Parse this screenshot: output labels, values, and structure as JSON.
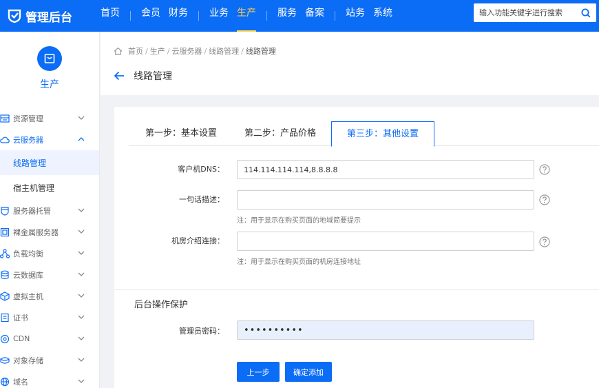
{
  "brand": {
    "logo_text": "管理后台"
  },
  "nav": {
    "items": [
      "首页",
      "会员",
      "财务",
      "业务",
      "生产",
      "服务",
      "备案",
      "站务",
      "系统"
    ],
    "active": "生产"
  },
  "search": {
    "placeholder": "输入功能关键字进行搜索"
  },
  "sidebar": {
    "title": "生产",
    "menu": [
      {
        "label": "资源管理",
        "icon": "resource-icon",
        "open": false
      },
      {
        "label": "云服务器",
        "icon": "cloud-icon",
        "open": true,
        "children": [
          {
            "label": "线路管理",
            "active": true
          },
          {
            "label": "宿主机管理",
            "active": false
          }
        ]
      },
      {
        "label": "服务器托管",
        "icon": "server-hosting-icon",
        "open": false
      },
      {
        "label": "裸金属服务器",
        "icon": "bare-metal-icon",
        "open": false
      },
      {
        "label": "负载均衡",
        "icon": "load-balance-icon",
        "open": false
      },
      {
        "label": "云数据库",
        "icon": "database-icon",
        "open": false
      },
      {
        "label": "虚拟主机",
        "icon": "virtual-host-icon",
        "open": false
      },
      {
        "label": "证书",
        "icon": "certificate-icon",
        "open": false
      },
      {
        "label": "CDN",
        "icon": "cdn-icon",
        "open": false
      },
      {
        "label": "对象存储",
        "icon": "object-storage-icon",
        "open": false
      },
      {
        "label": "域名",
        "icon": "domain-icon",
        "open": false
      }
    ]
  },
  "breadcrumb": [
    "首页",
    "生产",
    "云服务器",
    "线路管理",
    "线路管理"
  ],
  "page": {
    "title": "线路管理"
  },
  "tabs": [
    {
      "label": "第一步：基本设置",
      "active": false
    },
    {
      "label": "第二步：产品价格",
      "active": false
    },
    {
      "label": "第三步：其他设置",
      "active": true
    }
  ],
  "form": {
    "dns": {
      "label": "客户机DNS：",
      "value": "114.114.114.114,8.8.8.8"
    },
    "desc": {
      "label": "一句话描述：",
      "value": "",
      "note": "注：用于显示在购买页面的地域简要提示"
    },
    "link": {
      "label": "机房介绍连接：",
      "value": "",
      "note": "注：用于显示在购买页面的机房连接地址"
    },
    "section_title": "后台操作保护",
    "password": {
      "label": "管理员密码：",
      "value": "••••••••••"
    }
  },
  "buttons": {
    "prev": "上一步",
    "confirm": "确定添加"
  },
  "colors": {
    "primary": "#0b6cf5",
    "nav_active": "#ffd54f"
  }
}
